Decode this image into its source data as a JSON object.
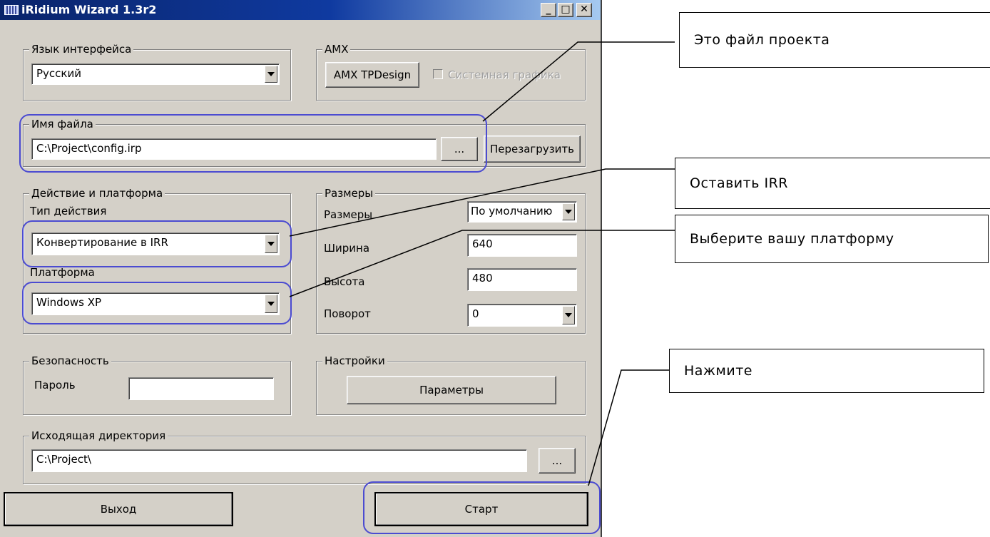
{
  "window": {
    "title": "iRidium Wizard 1.3r2",
    "minimize": "_",
    "maximize": "□",
    "close": "✕"
  },
  "language": {
    "group_label": "Язык интерфейса",
    "value": "Русский"
  },
  "amx": {
    "group_label": "AMX",
    "button_label": "AMX TPDesign",
    "checkbox_label": "Системная графика",
    "checked": false
  },
  "file": {
    "group_label": "Имя файла",
    "value": "C:\\Project\\config.irp",
    "browse_label": "...",
    "reload_label": "Перезагрузить"
  },
  "action": {
    "group_label": "Действие и платформа",
    "type_label": "Тип действия",
    "type_value": "Конвертирование в IRR",
    "platform_label": "Платформа",
    "platform_value": "Windows XP"
  },
  "sizes": {
    "group_label": "Размеры",
    "sizes_label": "Размеры",
    "sizes_value": "По умолчанию",
    "width_label": "Ширина",
    "width_value": "640",
    "height_label": "Высота",
    "height_value": "480",
    "rotation_label": "Поворот",
    "rotation_value": "0"
  },
  "security": {
    "group_label": "Безопасность",
    "password_label": "Пароль",
    "password_value": ""
  },
  "settings": {
    "group_label": "Настройки",
    "button_label": "Параметры"
  },
  "output": {
    "group_label": "Исходящая директория",
    "value": "C:\\Project\\",
    "browse_label": "..."
  },
  "buttons": {
    "exit_label": "Выход",
    "start_label": "Старт"
  },
  "callouts": {
    "project_file": "Это файл проекта",
    "keep_irr": "Оставить IRR",
    "choose_platform": "Выберите вашу платформу",
    "press": "Нажмите"
  },
  "colors": {
    "highlight": "#4b4bd1",
    "titlebar": "#0a246a",
    "window_bg": "#d4d0c8"
  }
}
